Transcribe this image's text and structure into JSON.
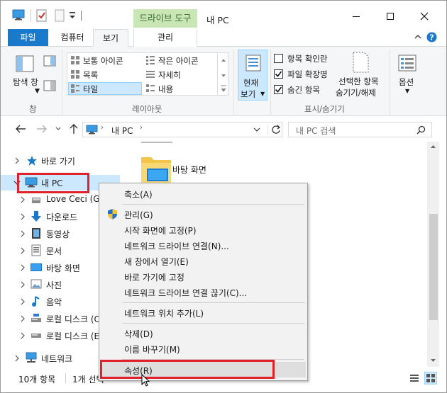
{
  "window": {
    "title": "내 PC",
    "context_tab": "드라이브 도구"
  },
  "tabs": {
    "file": "파일",
    "computer": "컴퓨터",
    "view": "보기",
    "manage": "관리"
  },
  "ribbon": {
    "panes": {
      "nav_pane": "탐색 창",
      "group": "창"
    },
    "layout": {
      "group": "레이아웃",
      "items": [
        "보통 아이콘",
        "작은 아이콘",
        "목록",
        "자세히",
        "타일",
        "내용"
      ],
      "selected": "타일"
    },
    "current_view": {
      "label1": "현재",
      "label2": "보기"
    },
    "show_hide": {
      "group": "표시/숨기기",
      "item_checkboxes": {
        "label": "항목 확인란",
        "checked": false
      },
      "file_extensions": {
        "label": "파일 확장명",
        "checked": true
      },
      "hidden_items": {
        "label": "숨긴 항목",
        "checked": true
      },
      "hide_selected_1": "선택한 항목",
      "hide_selected_2": "숨기기/해제"
    },
    "options": "옵션"
  },
  "address": {
    "path": "내 PC",
    "search_placeholder": "내 PC 검색"
  },
  "nav": {
    "items": [
      {
        "label": "바로 가기",
        "icon": "star-icon"
      },
      {
        "label": "내 PC",
        "icon": "pc-icon"
      },
      {
        "label": "Love Ceci (Ga",
        "icon": "drive-icon"
      },
      {
        "label": "다운로드",
        "icon": "download-icon"
      },
      {
        "label": "동영상",
        "icon": "video-icon"
      },
      {
        "label": "문서",
        "icon": "document-icon"
      },
      {
        "label": "바탕 화면",
        "icon": "desktop-icon"
      },
      {
        "label": "사진",
        "icon": "picture-icon"
      },
      {
        "label": "음악",
        "icon": "music-icon"
      },
      {
        "label": "로컬 디스크 (C",
        "icon": "disk-icon"
      },
      {
        "label": "로컬 디스크 (E",
        "icon": "disk-icon"
      },
      {
        "label": "네트워크",
        "icon": "network-icon"
      }
    ]
  },
  "content": {
    "folder_label": "바탕 화면"
  },
  "status": {
    "count": "10개 항목",
    "selected": "1개 선택"
  },
  "context_menu": {
    "items": [
      "축소(A)",
      "관리(G)",
      "시작 화면에 고정(P)",
      "네트워크 드라이브 연결(N)...",
      "새 창에서 열기(E)",
      "바로 가기에 고정",
      "네트워크 드라이브 연결 끊기(C)...",
      "네트워크 위치 추가(L)",
      "삭제(D)",
      "이름 바꾸기(M)",
      "속성(R)"
    ]
  },
  "colors": {
    "file_tab": "#1979ca",
    "context_tab_bg": "#c9e7b4",
    "selection": "#cce8ff",
    "highlight_box": "#e0202a"
  }
}
